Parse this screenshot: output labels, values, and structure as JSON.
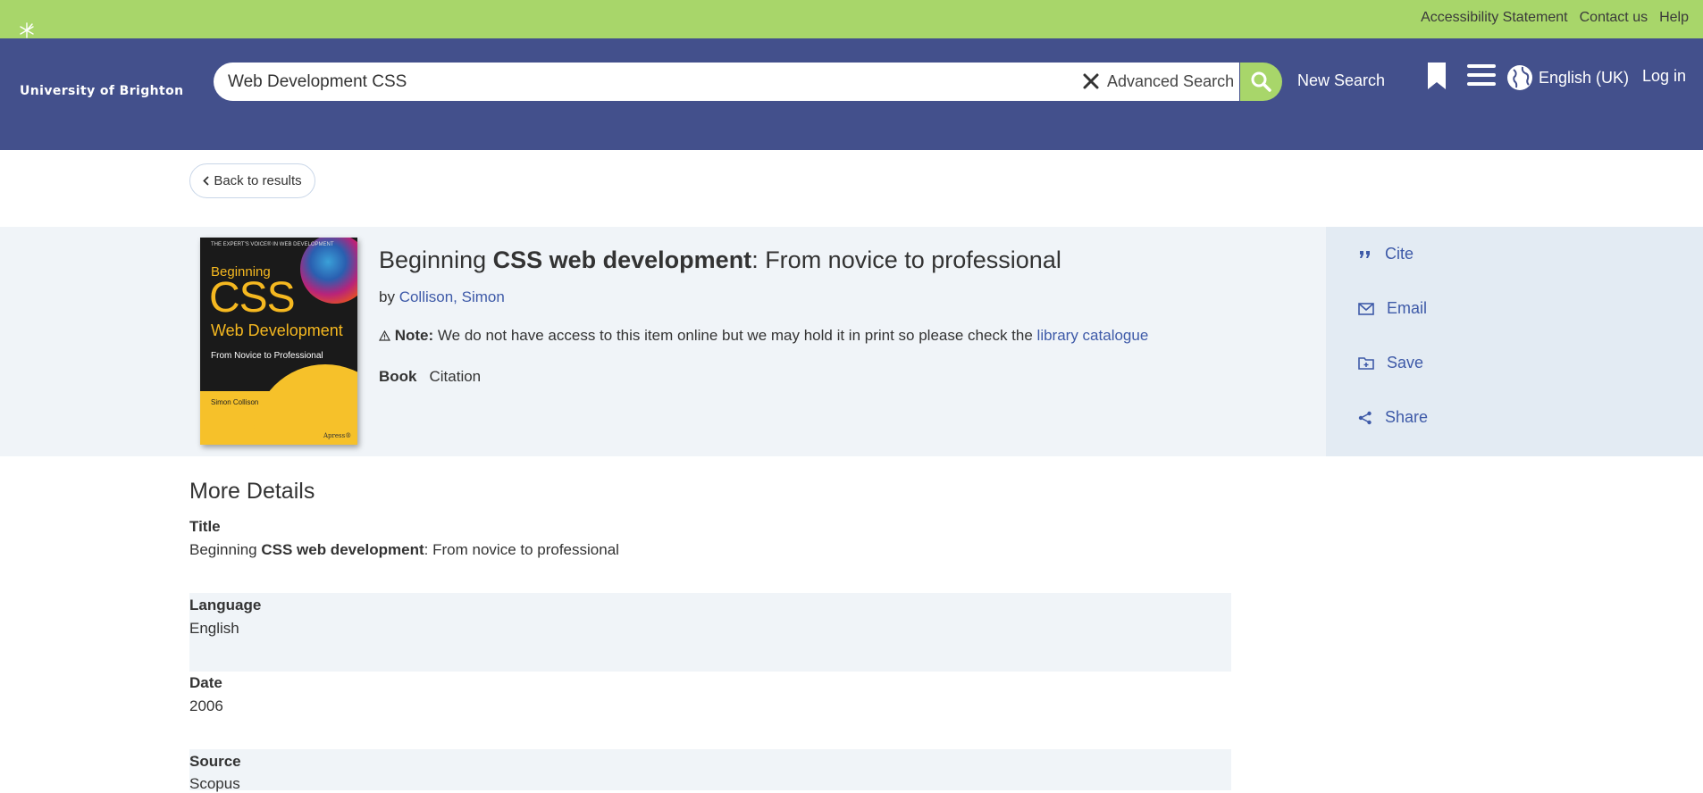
{
  "utility": {
    "accessibility": "Accessibility Statement",
    "contact": "Contact us",
    "help": "Help"
  },
  "header": {
    "logo_text": "University of Brighton",
    "search_value": "Web Development CSS",
    "advanced_search": "Advanced Search",
    "new_search": "New Search",
    "language": "English (UK)",
    "login": "Log in"
  },
  "nav": {
    "back": "Back to results"
  },
  "record": {
    "cover": {
      "topline": "THE EXPERT'S VOICE® IN WEB DEVELOPMENT",
      "line1": "Beginning",
      "line2": "CSS",
      "line3": "Web Development",
      "line4": "From Novice to Professional",
      "author": "Simon Collison",
      "publisher": "Apress®"
    },
    "title_pre": "Beginning ",
    "title_bold": "CSS web development",
    "title_post": ": From novice to professional",
    "by": "by",
    "author_link": "Collison, Simon",
    "note_label": "Note:",
    "note_text": "We do not have access to this item online but we may hold it in print so please check the",
    "note_link": "library catalogue",
    "format": "Book",
    "citation": "Citation"
  },
  "actions": {
    "cite": "Cite",
    "email": "Email",
    "save": "Save",
    "share": "Share"
  },
  "details": {
    "heading": "More Details",
    "title_label": "Title",
    "title_pre": "Beginning ",
    "title_bold": "CSS web development",
    "title_post": ": From novice to professional",
    "language_label": "Language",
    "language_value": "English",
    "date_label": "Date",
    "date_value": "2006",
    "source_label": "Source",
    "source_value": "Scopus"
  },
  "colors": {
    "utility_bar": "#a8d66a",
    "header": "#43508c",
    "link": "#3e5aa8",
    "panel": "#f0f4f8",
    "sidebar": "#e3ebf3"
  }
}
